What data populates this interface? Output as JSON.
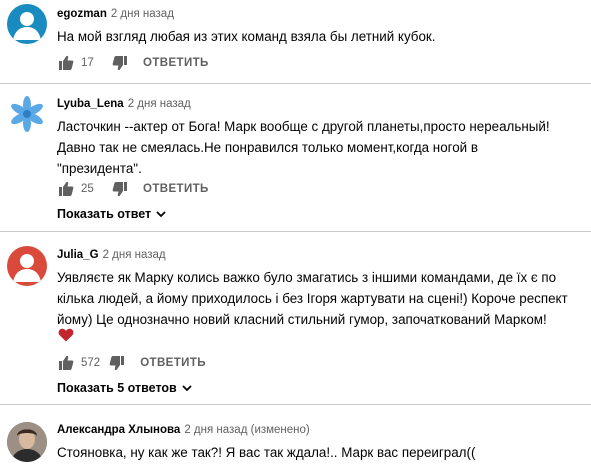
{
  "colors": {
    "text": "#030303",
    "secondary": "#606060",
    "heart": "#c4262e",
    "avatar_egozman": "#1a8bc0",
    "avatar_julia": "#d94a3a"
  },
  "comments": [
    {
      "author": "egozman",
      "time": "2 дня назад",
      "lines": [
        "На мой взгляд любая из этих команд взяла бы летний кубок."
      ],
      "likes": "17",
      "reply_label": "ОТВЕТИТЬ",
      "avatar_icon": "user-silhouette-icon"
    },
    {
      "author": "Lyuba_Lena",
      "time": "2 дня назад",
      "lines": [
        "Ласточкин --актер от Бога! Марк вообще с другой планеты,просто нереальный!",
        "Давно так не смеялась.Не понравился только момент,когда ногой в",
        "\"президента\"."
      ],
      "likes": "25",
      "reply_label": "ОТВЕТИТЬ",
      "show_replies": "Показать ответ",
      "avatar_icon": "snowflake-icon"
    },
    {
      "author": "Julia_G",
      "time": "2 дня назад",
      "lines": [
        "Уявляєте як Марку колись важко було змагатись з іншими командами, де їх є по",
        "кілька людей, а йому приходилось і без Ігоря жартувати на сцені!) Короче респект",
        "йому) Це однозначно новий класний стильний гумор, започаткований Марком!"
      ],
      "likes": "572",
      "reply_label": "ОТВЕТИТЬ",
      "show_replies": "Показать 5 ответов",
      "heart_icon": "heart-icon",
      "avatar_icon": "user-silhouette-icon"
    },
    {
      "author": "Александра Хлынова",
      "time": "2 дня назад (изменено)",
      "lines": [
        "Стояновка, ну как же так?! Я вас так ждала!.. Марк вас переиграл(("
      ],
      "avatar_icon": "photo-avatar-icon"
    }
  ]
}
